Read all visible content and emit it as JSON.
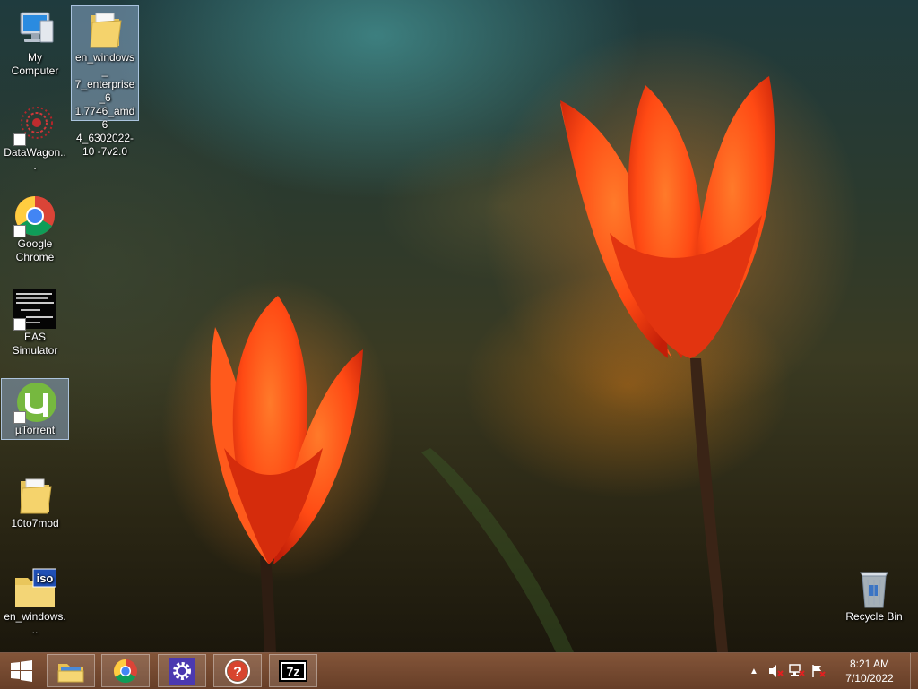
{
  "desktop": {
    "icons": [
      {
        "id": "my-computer",
        "label": "My Computer",
        "icon": "computer-icon",
        "shortcut": false,
        "selected": false
      },
      {
        "id": "iso-folder",
        "label": "en_windows_ 7_enterprise_6 1.7746_amd6 4_6302022-10 -7v2.0",
        "icon": "folder-icon",
        "shortcut": false,
        "selected": true
      },
      {
        "id": "datawagon",
        "label": "DataWagon...",
        "icon": "datawagon-icon",
        "shortcut": true,
        "selected": false
      },
      {
        "id": "chrome",
        "label": "Google Chrome",
        "icon": "chrome-icon",
        "shortcut": true,
        "selected": false
      },
      {
        "id": "eas",
        "label": "EAS Simulator",
        "icon": "eas-simulator-icon",
        "shortcut": true,
        "selected": false
      },
      {
        "id": "utorrent",
        "label": "µTorrent",
        "icon": "utorrent-icon",
        "shortcut": true,
        "selected": true
      },
      {
        "id": "10to7mod",
        "label": "10to7mod",
        "icon": "folder-icon",
        "shortcut": false,
        "selected": false
      },
      {
        "id": "iso-file",
        "label": "en_windows...",
        "icon": "iso-file-icon",
        "shortcut": false,
        "selected": false
      },
      {
        "id": "recycle-bin",
        "label": "Recycle Bin",
        "icon": "recycle-bin-icon",
        "shortcut": false,
        "selected": false
      }
    ]
  },
  "taskbar": {
    "pinned": [
      {
        "id": "explorer",
        "icon": "file-explorer-icon"
      },
      {
        "id": "chrome",
        "icon": "chrome-icon"
      },
      {
        "id": "settings",
        "icon": "gear-icon"
      },
      {
        "id": "help",
        "icon": "help-icon",
        "text": "?"
      },
      {
        "id": "7zip",
        "icon": "7zip-icon",
        "text": "7z"
      }
    ],
    "tray": {
      "overflow": "▲",
      "volume": "volume-muted-icon",
      "network": "network-disconnected-icon",
      "flag": "action-center-flag-icon"
    },
    "clock": {
      "time": "8:21 AM",
      "date": "7/10/2022"
    }
  },
  "colors": {
    "taskbar": "#6a3b20",
    "selection": "#a0bee6",
    "tulip": "#ff4a14"
  }
}
